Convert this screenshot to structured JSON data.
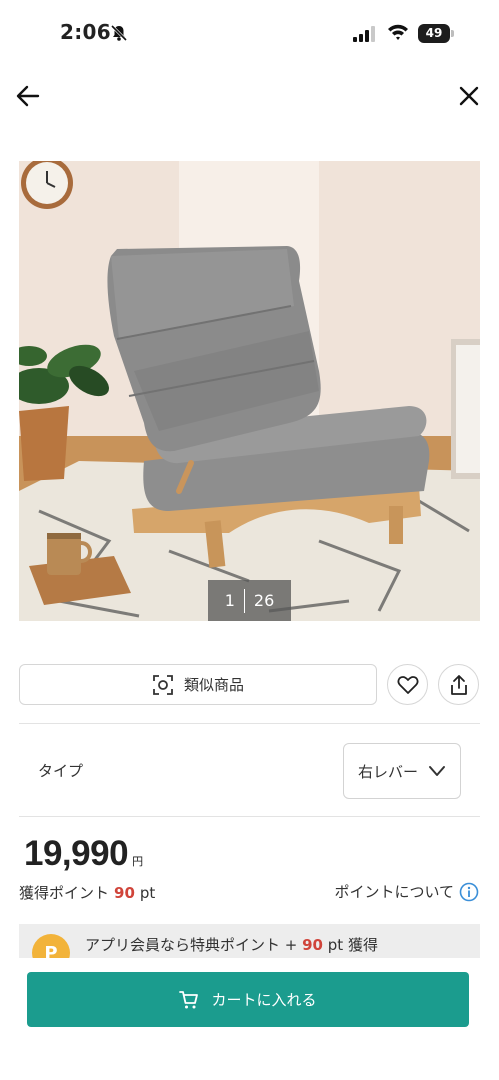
{
  "status_bar": {
    "time": "2:06",
    "battery": "49",
    "icons": [
      "bell-slash-icon",
      "signal-icon",
      "wifi-icon",
      "battery-icon"
    ]
  },
  "nav": {
    "back_icon": "arrow-left-icon",
    "close_icon": "close-icon"
  },
  "gallery": {
    "current": "1",
    "total": "26",
    "image_description_icon": "product-photo"
  },
  "actions": {
    "similar_label": "類似商品",
    "similar_icon": "camera-scan-icon",
    "favorite_icon": "heart-icon",
    "share_icon": "share-icon"
  },
  "option": {
    "label": "タイプ",
    "selected": "右レバー"
  },
  "price": {
    "value": "19,990",
    "unit": "円"
  },
  "points": {
    "prefix": "獲得ポイント",
    "value": "90",
    "suffix": "pt",
    "about_label": "ポイントについて"
  },
  "app_banner": {
    "coin_label": "P",
    "text_before": "アプリ会員なら特典ポイント +",
    "value": "90",
    "text_after": "pt 獲得"
  },
  "cart": {
    "label": "カートに入れる",
    "icon": "cart-icon"
  },
  "colors": {
    "accent": "#1b9c8e",
    "points_red": "#d0443a",
    "coin": "#f2b33a"
  }
}
